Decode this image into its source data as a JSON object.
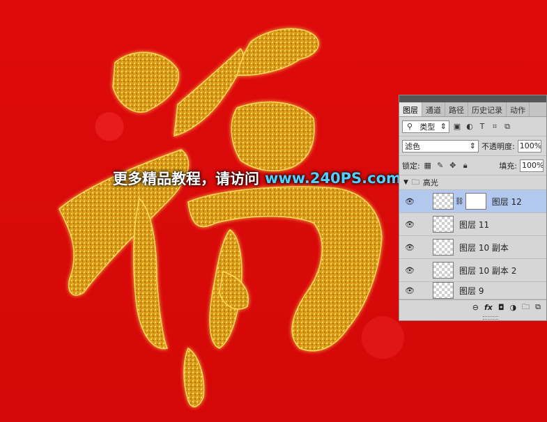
{
  "artwork": {
    "character": "福",
    "background_color": "#e00a0a",
    "gold_color": "#e3a61a"
  },
  "watermark": {
    "text_cn": "更多精品教程，请访问",
    "url": "www.240PS.com"
  },
  "layers_panel": {
    "tabs": [
      "图层",
      "通道",
      "路径",
      "历史记录",
      "动作"
    ],
    "active_tab": "图层",
    "filter_kind": "类型",
    "blend_mode": "滤色",
    "opacity_label": "不透明度:",
    "opacity_value": "100%",
    "lock_label": "锁定:",
    "fill_label": "填充:",
    "fill_value": "100%",
    "group_name": "高光",
    "layers": [
      {
        "name": "图层 12",
        "selected": true
      },
      {
        "name": "图层 11",
        "selected": false
      },
      {
        "name": "图层 10 副本",
        "selected": false
      },
      {
        "name": "图层 10 副本 2",
        "selected": false
      },
      {
        "name": "图层 9",
        "selected": false
      }
    ],
    "bottom_icons": [
      "link-icon",
      "fx-icon",
      "mask-icon",
      "adjustment-icon",
      "folder-icon",
      "new-layer-icon"
    ],
    "bottom_fx_label": "fx"
  }
}
